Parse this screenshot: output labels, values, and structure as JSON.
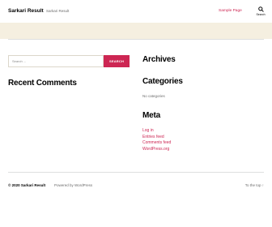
{
  "header": {
    "site_title": "Sarkari Result",
    "site_description": "Sarkari Result",
    "nav_link": "Sample Page",
    "search_toggle_label": "Search"
  },
  "search": {
    "placeholder": "Search ...",
    "button_label": "SEARCH"
  },
  "widgets": {
    "recent_comments_title": "Recent Comments",
    "archives_title": "Archives",
    "categories_title": "Categories",
    "no_categories": "No categories",
    "meta_title": "Meta",
    "meta_links": [
      "Log in",
      "Entries feed",
      "Comments feed",
      "WordPress.org"
    ]
  },
  "footer": {
    "copyright": "© 2020 Sarkari Result",
    "powered_by": "Powered by WordPress",
    "to_top": "To the top",
    "to_top_arrow": "↑"
  },
  "colors": {
    "accent": "#cd2653",
    "background": "#f5efe0",
    "text_secondary": "#6d6d6d"
  }
}
